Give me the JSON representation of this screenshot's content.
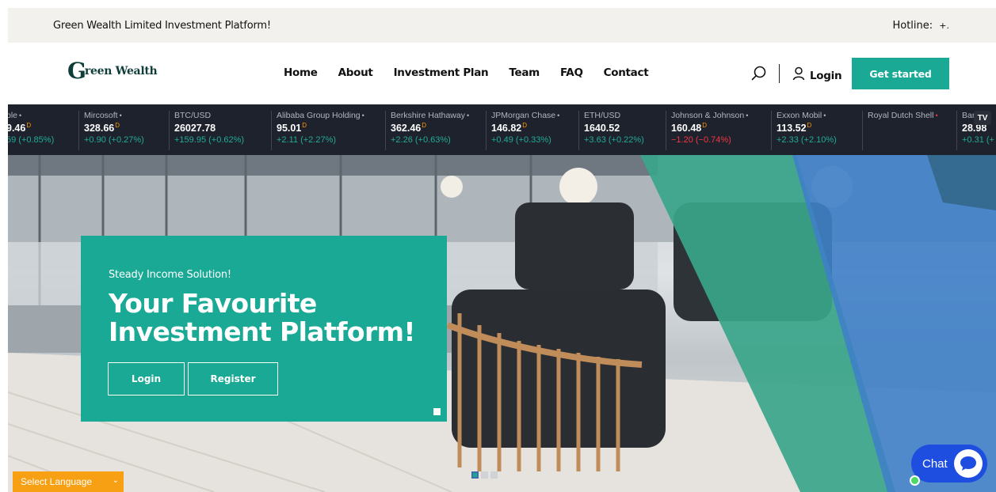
{
  "topbar": {
    "tagline": "Green Wealth Limited Investment Platform!",
    "hotline_label": "Hotline:",
    "hotline_value": "+."
  },
  "header": {
    "logo_initial": "G",
    "logo_rest": "reen Wealth",
    "nav": [
      "Home",
      "About",
      "Investment Plan",
      "Team",
      "FAQ",
      "Contact"
    ],
    "login_label": "Login",
    "cta_label": "Get started",
    "accent_color": "#1aa995"
  },
  "ticker": {
    "items": [
      {
        "name": "ple",
        "dot": "•",
        "price": "9.46",
        "flag": "D",
        "change": "59 (+0.85%)",
        "dir": "up"
      },
      {
        "name": "Mircosoft",
        "dot": "•",
        "price": "328.66",
        "flag": "D",
        "change": "+0.90 (+0.27%)",
        "dir": "up"
      },
      {
        "name": "BTC/USD",
        "dot": "",
        "price": "26027.78",
        "flag": "",
        "change": "+159.95 (+0.62%)",
        "dir": "up"
      },
      {
        "name": "Alibaba Group Holding",
        "dot": "•",
        "price": "95.01",
        "flag": "D",
        "change": "+2.11 (+2.27%)",
        "dir": "up"
      },
      {
        "name": "Berkshire Hathaway",
        "dot": "•",
        "price": "362.46",
        "flag": "D",
        "change": "+2.26 (+0.63%)",
        "dir": "up"
      },
      {
        "name": "JPMorgan Chase",
        "dot": "•",
        "price": "146.82",
        "flag": "D",
        "change": "+0.49 (+0.33%)",
        "dir": "up"
      },
      {
        "name": "ETH/USD",
        "dot": "",
        "price": "1640.52",
        "flag": "",
        "change": "+3.63 (+0.22%)",
        "dir": "up"
      },
      {
        "name": "Johnson & Johnson",
        "dot": "•",
        "price": "160.48",
        "flag": "D",
        "change": "−1.20 (−0.74%)",
        "dir": "down"
      },
      {
        "name": "Exxon Mobil",
        "dot": "•",
        "price": "113.52",
        "flag": "D",
        "change": "+2.33 (+2.10%)",
        "dir": "up"
      },
      {
        "name": "Royal Dutch Shell",
        "dot": "•",
        "price": "",
        "flag": "",
        "change": "",
        "dir": "down"
      },
      {
        "name": "Bar",
        "dot": "",
        "price": "28.98",
        "flag": "",
        "change": "+0.31 (+",
        "dir": "up"
      }
    ],
    "badge": "TV"
  },
  "hero": {
    "kicker": "Steady Income Solution!",
    "title": "Your Favourite Investment Platform!",
    "login_label": "Login",
    "register_label": "Register"
  },
  "slider": {
    "active_index": 0,
    "count": 3
  },
  "chat": {
    "label": "Chat"
  },
  "language": {
    "label": "Select Language"
  }
}
